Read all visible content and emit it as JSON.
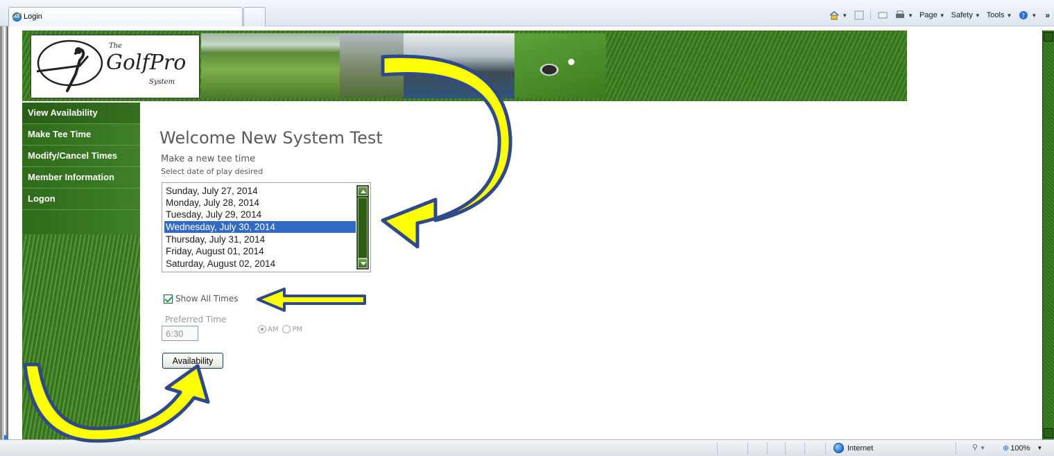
{
  "browser": {
    "tab_title": "Login",
    "commands": {
      "page": "Page",
      "safety": "Safety",
      "tools": "Tools",
      "overflow": "»"
    }
  },
  "logo": {
    "prefix": "The",
    "name": "GolfPro",
    "suffix": "System"
  },
  "sidebar": {
    "items": [
      {
        "label": "View Availability"
      },
      {
        "label": "Make Tee Time"
      },
      {
        "label": "Modify/Cancel Times"
      },
      {
        "label": "Member Information"
      },
      {
        "label": "Logon"
      }
    ]
  },
  "main": {
    "welcome": "Welcome New System Test",
    "subtitle": "Make a new tee time",
    "date_prompt": "Select date of play desired",
    "dates": [
      "Sunday, July 27, 2014",
      "Monday, July 28, 2014",
      "Tuesday, July 29, 2014",
      "Wednesday, July 30, 2014",
      "Thursday, July 31, 2014",
      "Friday, August 01, 2014",
      "Saturday, August 02, 2014"
    ],
    "selected_date": "Wednesday, July 30, 2014",
    "show_all_times": {
      "label": "Show All Times",
      "checked": true
    },
    "preferred_time": {
      "label": "Preferred Time",
      "value": "6:30"
    },
    "ampm": {
      "am": "AM",
      "pm": "PM",
      "selected": "AM"
    },
    "availability_button": "Availability"
  },
  "statusbar": {
    "zone": "Internet",
    "zoom": "100%"
  },
  "colors": {
    "nav_green": "#3f8028",
    "selection_blue": "#316ac5",
    "arrow_yellow": "#ffff00",
    "arrow_outline": "#2f4a8a"
  }
}
